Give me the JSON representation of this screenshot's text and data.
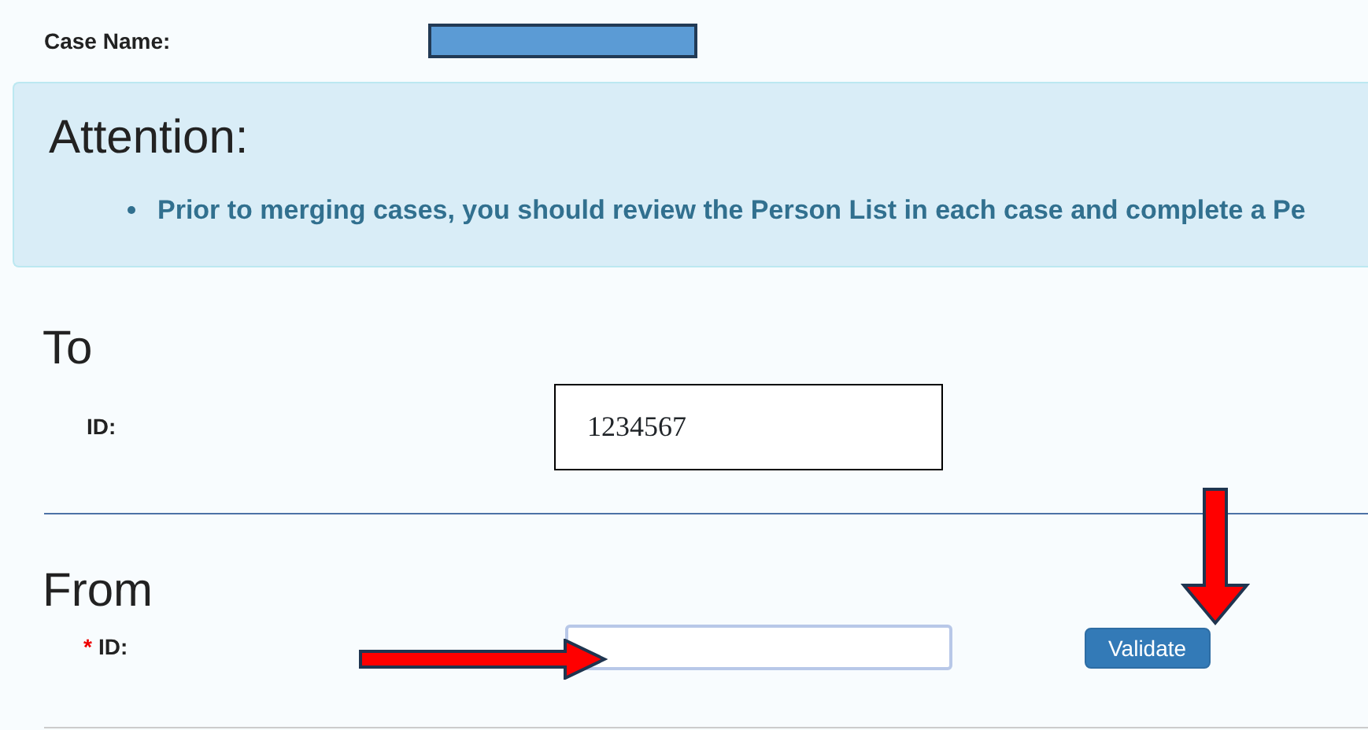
{
  "case_name": {
    "label": "Case Name:",
    "value_redacted": true
  },
  "attention": {
    "title": "Attention:",
    "items": [
      "Prior to merging cases, you should review the Person List in each case and complete a Pe"
    ]
  },
  "to_section": {
    "title": "To",
    "field": {
      "label": "ID:",
      "value": "1234567"
    }
  },
  "from_section": {
    "title": "From",
    "field": {
      "label": "ID:",
      "required_mark": "*"
    },
    "button": "Validate"
  },
  "annotations": [
    {
      "kind": "arrow_right"
    },
    {
      "kind": "arrow_down"
    }
  ]
}
